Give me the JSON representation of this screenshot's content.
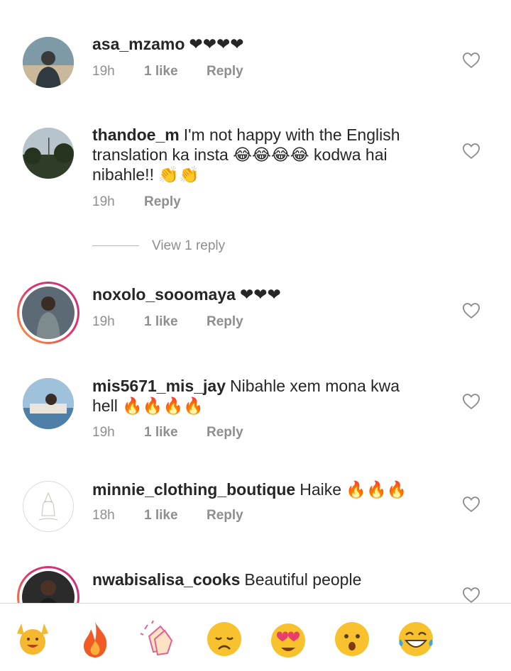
{
  "comments": [
    {
      "username": "asa_mzamo",
      "text": "❤❤❤❤",
      "time": "19h",
      "likes": "1 like",
      "reply_label": "Reply"
    },
    {
      "username": "thandoe_m",
      "text": "I'm not happy with the English translation ka insta 😂😂😂😂 kodwa hai nibahle!! 👏👏",
      "time": "19h",
      "reply_label": "Reply"
    },
    {
      "username": "noxolo_sooomaya",
      "text": "❤❤❤",
      "time": "19h",
      "likes": "1 like",
      "reply_label": "Reply"
    },
    {
      "username": "mis5671_mis_jay",
      "text": "Nibahle xem mona kwa hell 🔥🔥🔥🔥",
      "time": "19h",
      "likes": "1 like",
      "reply_label": "Reply"
    },
    {
      "username": "minnie_clothing_boutique",
      "text": "Haike 🔥🔥🔥",
      "time": "18h",
      "likes": "1 like",
      "reply_label": "Reply"
    },
    {
      "username": "nwabisalisa_cooks",
      "text": "Beautiful people"
    }
  ],
  "view_replies": "View 1 reply",
  "reactions": [
    {
      "icon": "raising-hands-emoji",
      "glyph": "🙌"
    },
    {
      "icon": "fire-emoji",
      "glyph": "🔥"
    },
    {
      "icon": "clapping-hands-emoji",
      "glyph": "👏"
    },
    {
      "icon": "sad-face-emoji",
      "glyph": "😢"
    },
    {
      "icon": "heart-eyes-emoji",
      "glyph": "😍"
    },
    {
      "icon": "surprised-face-emoji",
      "glyph": "😮"
    },
    {
      "icon": "laughing-tears-emoji",
      "glyph": "😂"
    }
  ],
  "colors": {
    "text": "#262626",
    "secondary": "#8e8e8e",
    "story_ring_start": "#f9a33b",
    "story_ring_end": "#c13584"
  }
}
